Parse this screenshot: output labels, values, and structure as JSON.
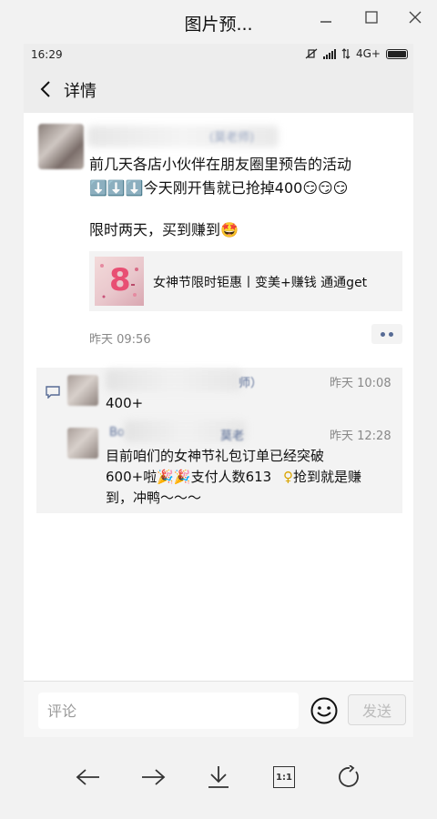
{
  "viewer": {
    "title": "图片预..."
  },
  "statusbar": {
    "time": "16:29",
    "network": "4G+"
  },
  "navbar": {
    "title": "详情"
  },
  "post": {
    "author_suffix": "(莫老师)",
    "line1": "前几天各店小伙伴在朋友圈里预告的活动",
    "line2_emojis": "⬇️⬇️⬇️",
    "line2_text": "今天刚开售就已抢掉400",
    "line2_tail_emojis": "😏😏😏",
    "line3_text": "限时两天，买到赚到",
    "line3_emoji": "🤩",
    "link_card": {
      "thumb_text": "8",
      "title": "女神节限时钜惠丨变美+赚钱 通通get"
    },
    "time": "昨天 09:56"
  },
  "comments": [
    {
      "name_suffix": "师）",
      "time": "昨天 10:08",
      "text": "400+"
    },
    {
      "name_prefix": "Bo",
      "name_suffix": "莫老",
      "time": "昨天 12:28",
      "text_line1": "目前咱们的女神节礼包订单已经突破",
      "text_line2a": "600+啦",
      "text_line2_emojis": "🎉🎉",
      "text_line2b": "支付人数613",
      "text_line2_icon": "♀",
      "text_line2c": "抢到就是赚",
      "text_line3": "到，冲鸭～～～"
    }
  ],
  "comment_bar": {
    "placeholder": "评论",
    "send_label": "发送"
  },
  "toolbar": {
    "zoom_label": "1:1"
  }
}
